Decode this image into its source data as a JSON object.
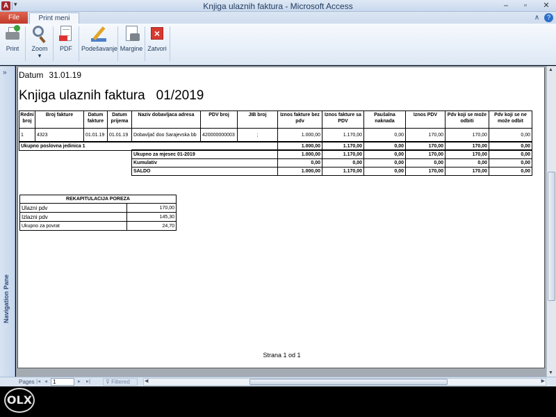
{
  "window": {
    "app_icon": "A",
    "title": "Knjiga ulaznih faktura  -  Microsoft Access",
    "min_glyph": "–",
    "max_glyph": "▫",
    "close_glyph": "✕"
  },
  "ribbon_tabs": {
    "file": "File",
    "print_preview": "Print meni",
    "help_controls": "∧"
  },
  "ribbon": {
    "buttons": [
      {
        "label": "Print",
        "icon": "printer-icon"
      },
      {
        "label": "Zoom",
        "icon": "zoom-icon"
      },
      {
        "label": "PDF",
        "icon": "pdf-icon"
      },
      {
        "label": "Podešavanje",
        "icon": "page-setup-icon"
      },
      {
        "label": "Margine",
        "icon": "margins-icon"
      },
      {
        "label": "Zatvori",
        "icon": "close-preview-icon"
      }
    ],
    "zoom_dropdown": "▾"
  },
  "nav_pane": {
    "label": "Navigation Pane",
    "toggle": "»"
  },
  "report": {
    "date_label": "Datum",
    "date_value": "31.01.19",
    "title": "Knjiga ulaznih faktura",
    "period": "01/2019",
    "columns": [
      "Redni broj",
      "Broj fakture",
      "Datum fakture",
      "Datum prijema",
      "Naziv dobavljaca adresa",
      "PDV broj",
      "JIB broj",
      "Iznos fakture bez pdv",
      "Iznos fakture sa PDV",
      "Paušalna naknada",
      "Iznos PDV",
      "Pdv koji se može odbiti",
      "Pdv koji se ne može odbit"
    ],
    "rows": [
      [
        "1",
        "4323",
        "01.01.19",
        "01.01.19",
        "Dobavljač doo Sarajevska bb",
        "420000000003",
        ";",
        "1.000,00",
        "1.170,00",
        "0,00",
        "170,00",
        "170,00",
        "0,00"
      ]
    ],
    "unit_total": {
      "label": "Ukupno poslovna jedinica 1",
      "values": [
        "1.000,00",
        "1.170,00",
        "0,00",
        "170,00",
        "170,00",
        "0,00"
      ]
    },
    "month_totals": [
      {
        "label": "Ukupno za mjesec 01-2019",
        "values": [
          "1.000,00",
          "1.170,00",
          "0,00",
          "170,00",
          "170,00",
          "0,00"
        ]
      },
      {
        "label": "Kumulativ",
        "values": [
          "0,00",
          "0,00",
          "0,00",
          "0,00",
          "0,00",
          "0,00"
        ]
      },
      {
        "label": "SALDO",
        "values": [
          "1.000,00",
          "1.170,00",
          "0,00",
          "170,00",
          "170,00",
          "0,00"
        ]
      }
    ],
    "recap": {
      "title": "REKAPITULACIJA POREZA",
      "rows": [
        {
          "label": "Ulazni pdv",
          "value": "170,00"
        },
        {
          "label": "Izlazni pdv",
          "value": "145,30"
        },
        {
          "label": "Ukupno za povrat",
          "value": "24,70"
        }
      ]
    },
    "footer": "Strana 1 od 1"
  },
  "statusbar": {
    "pages_label": "Pages",
    "page_value": "1",
    "filter_label": "Filtered",
    "nav_first": "|◂",
    "nav_prev": "◂",
    "nav_next": "▸",
    "nav_last": "▸|"
  },
  "watermark": "OLX"
}
